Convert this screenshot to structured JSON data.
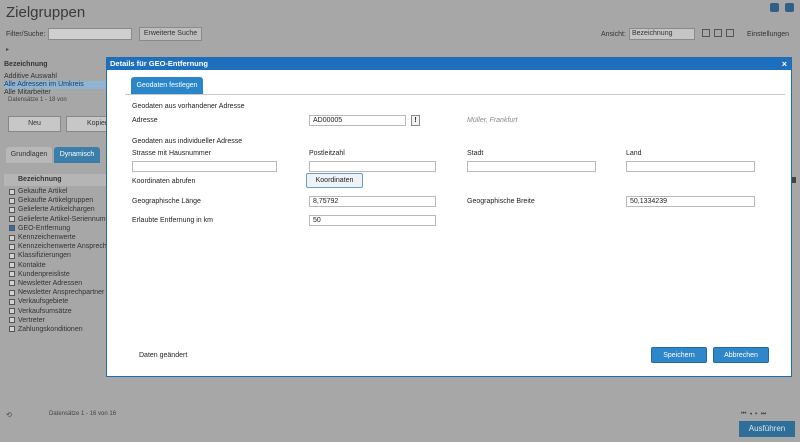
{
  "page": {
    "title": "Zielgruppen",
    "filter_label": "Filter/Suche:",
    "filter_value": "",
    "extended_search": "Erweiterte Suche",
    "view_label": "Ansicht:",
    "view_value": "Bezeichnung",
    "settings": "Einstellungen",
    "column_header": "Bezeichnung",
    "top_list": [
      "Additive Auswahl",
      "Alle Adressen im Umkreis",
      "Alle Mitarbeiter"
    ],
    "records_top": "Datensätze 1 - 18 von",
    "new_button": "Neu",
    "copy_button": "Kopier",
    "tab_basics": "Grundlagen",
    "tab_dynamic": "Dynamisch",
    "list_header": "Bezeichnung",
    "list": [
      {
        "label": "Gekaufte Artikel",
        "checked": false
      },
      {
        "label": "Gekaufte Artikelgruppen",
        "checked": false
      },
      {
        "label": "Gelieferte Artikelchargen",
        "checked": false
      },
      {
        "label": "Gelieferte Artikel-Seriennummern",
        "checked": false
      },
      {
        "label": "GEO-Entfernung",
        "checked": true
      },
      {
        "label": "Kennzeichenwerte",
        "checked": false
      },
      {
        "label": "Kennzeichenwerte Ansprechpartner",
        "checked": false
      },
      {
        "label": "Klassifizierungen",
        "checked": false
      },
      {
        "label": "Kontakte",
        "checked": false
      },
      {
        "label": "Kundenpreisliste",
        "checked": false
      },
      {
        "label": "Newsletter Adressen",
        "checked": false
      },
      {
        "label": "Newsletter Ansprechpartner",
        "checked": false
      },
      {
        "label": "Verkaufsgebiete",
        "checked": false
      },
      {
        "label": "Verkaufsumsätze",
        "checked": false
      },
      {
        "label": "Vertreter",
        "checked": false
      },
      {
        "label": "Zahlungskonditionen",
        "checked": false
      }
    ],
    "records_bottom": "Datensätze 1 - 16 von 16",
    "run_button": "Ausführen"
  },
  "modal": {
    "title": "Details für GEO-Entfernung",
    "close": "×",
    "tab": "Geodaten festlegen",
    "section_existing": "Geodaten aus vorhandener Adresse",
    "address_label": "Adresse",
    "address_value": "AD00005",
    "address_button": "!",
    "address_hint": "Müller, Frankfurt",
    "section_individual": "Geodaten aus individueller Adresse",
    "street_label": "Strasse mit Hausnummer",
    "street_value": "",
    "zip_label": "Postleitzahl",
    "zip_value": "",
    "city_label": "Stadt",
    "city_value": "",
    "country_label": "Land",
    "country_value": "",
    "coords_label": "Koordinaten abrufen",
    "coords_button": "Koordinaten",
    "lon_label": "Geographische Länge",
    "lon_value": "8,75792",
    "lat_label": "Geographische Breite",
    "lat_value": "50,1334239",
    "distance_label": "Erlaubte Entfernung in km",
    "distance_value": "50",
    "status": "Daten geändert",
    "save_button": "Speichern",
    "cancel_button": "Abbrechen"
  }
}
